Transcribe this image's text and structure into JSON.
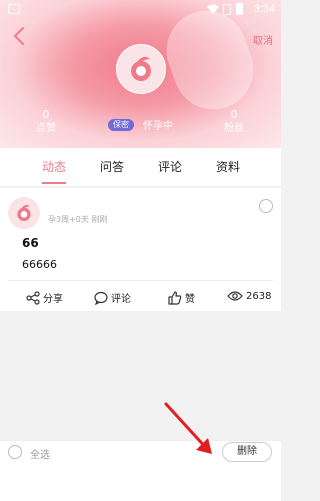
{
  "statusbar": {
    "time": "3:34"
  },
  "header": {
    "cancel_label": "取消",
    "stats": [
      {
        "value": "0",
        "label": "点赞"
      },
      {
        "value": "0",
        "label": "粉丝"
      }
    ],
    "badge": "保密",
    "status": "怀孕中"
  },
  "tabs": [
    {
      "label": "动态"
    },
    {
      "label": "问答"
    },
    {
      "label": "评论"
    },
    {
      "label": "资料"
    }
  ],
  "post": {
    "meta": "孕3周+0天   刚刚",
    "title": "66",
    "body": "66666",
    "actions": {
      "share": "分享",
      "comment": "评论",
      "like": "赞",
      "views": "2638"
    }
  },
  "bottom": {
    "select_all": "全选",
    "delete": "删除"
  },
  "colors": {
    "accent": "#f07a8a",
    "badge": "#6f6bd9"
  }
}
